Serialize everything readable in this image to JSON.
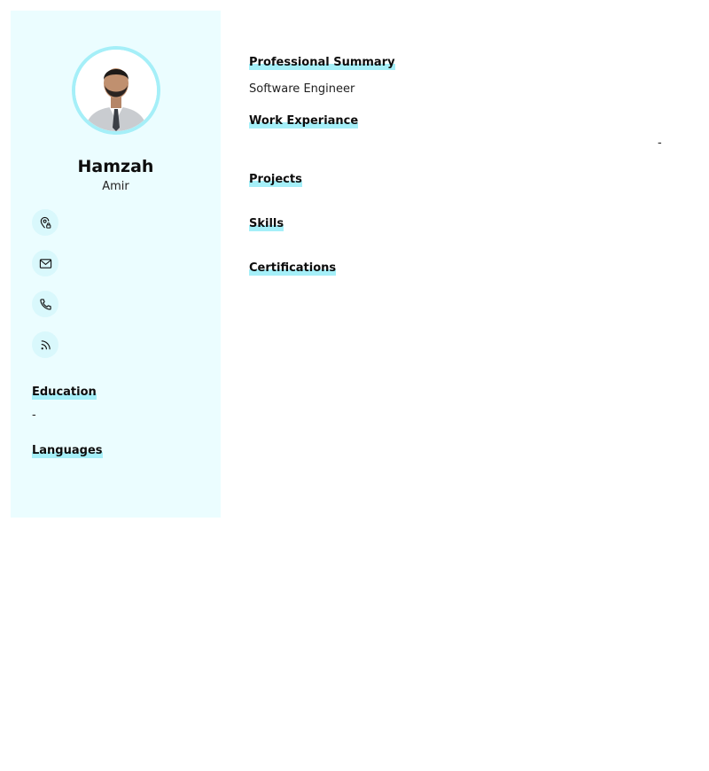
{
  "profile": {
    "first_name": "Hamzah",
    "last_name": "Amir"
  },
  "contacts": [
    {
      "icon": "location-pin-icon"
    },
    {
      "icon": "mail-icon"
    },
    {
      "icon": "phone-icon"
    },
    {
      "icon": "rss-icon"
    }
  ],
  "sidebar": {
    "education_heading": "Education",
    "education_value": "-",
    "languages_heading": "Languages"
  },
  "main": {
    "summary_heading": "Professional Summary",
    "summary_text": "Software Engineer",
    "work_heading": "Work Experiance",
    "work_dash": "-",
    "projects_heading": "Projects",
    "skills_heading": "Skills",
    "certifications_heading": "Certifications"
  },
  "colors": {
    "sidebar_bg": "#ebfdff",
    "accent": "#a5eff8",
    "icon_bg": "#d9f8fc"
  }
}
